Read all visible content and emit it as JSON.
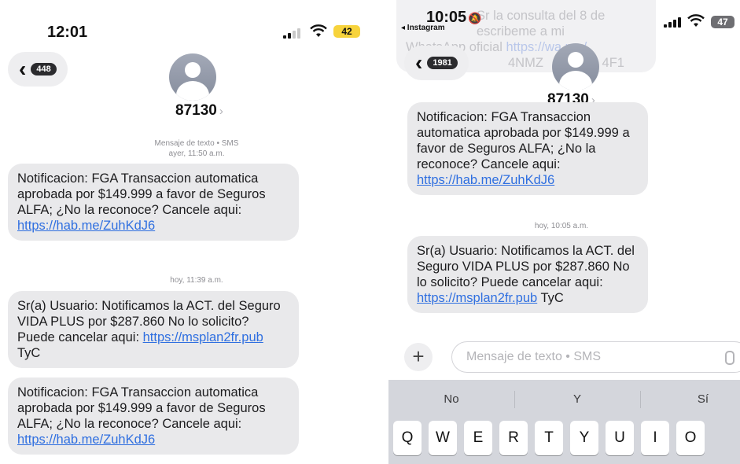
{
  "left": {
    "status": {
      "time": "12:01",
      "battery": "42"
    },
    "header": {
      "unread_count": "448",
      "contact": "87130"
    },
    "messages": [
      {
        "meta_line1": "Mensaje de texto • SMS",
        "meta_line2": "ayer, 11:50 a.m.",
        "pre": "Notificacion: FGA Transaccion automatica aprobada por $149.999 a favor de Seguros ALFA; ¿No la reconoce? Cancele aqui:",
        "link": "https://hab.me/ZuhKdJ6",
        "post": ""
      },
      {
        "meta_line1": "hoy, 11:39 a.m.",
        "pre": "Sr(a) Usuario: Notificamos la ACT. del Seguro VIDA PLUS por $287.860 No lo solicito? Puede cancelar aqui:",
        "link": "https://msplan2fr.pub",
        "post": "TyC"
      },
      {
        "pre": "Notificacion: FGA Transaccion automatica aprobada por $149.999 a favor de Seguros ALFA; ¿No la reconoce? Cancele aqui:",
        "link": "https://hab.me/ZuhKdJ6",
        "post": ""
      }
    ]
  },
  "right": {
    "status": {
      "time": "10:05",
      "back_app": "◂ Instagram",
      "battery": "47"
    },
    "overlay_text": {
      "line1": "Sr la consulta del 8 de",
      "line2": "escribeme a mi",
      "line3": "WhatsApp oficial",
      "link": "https://wa.me/",
      "line4": "4NMZ",
      "line5": "4F1"
    },
    "header": {
      "unread_count": "1981",
      "contact": "87130"
    },
    "messages": [
      {
        "pre": "Notificacion: FGA Transaccion automatica aprobada por $149.999 a favor de Seguros ALFA; ¿No la reconoce? Cancele aqui:",
        "link": "https://hab.me/ZuhKdJ6",
        "post": ""
      },
      {
        "meta_line1": "hoy, 10:05 a.m.",
        "pre": "Sr(a) Usuario: Notificamos la ACT. del Seguro VIDA PLUS por $287.860 No lo solicito? Puede cancelar aqui:",
        "link": "https://msplan2fr.pub",
        "post": "TyC"
      }
    ],
    "input": {
      "placeholder": "Mensaje de texto • SMS",
      "plus": "+"
    },
    "keyboard": {
      "suggestions": [
        "No",
        "Y",
        "Sí"
      ],
      "row1": [
        "Q",
        "W",
        "E",
        "R",
        "T",
        "Y",
        "U",
        "I",
        "O"
      ]
    }
  },
  "colors": {
    "bubble": "#e9e9eb",
    "link": "#2f6fe0",
    "battery_yellow": "#f7d33c",
    "keyboard": "#d4d6dc"
  },
  "icons": [
    "back-chevron-icon",
    "signal-icon",
    "wifi-icon",
    "battery-icon",
    "avatar-icon",
    "bell-slash-icon",
    "mic-icon",
    "plus-icon"
  ]
}
